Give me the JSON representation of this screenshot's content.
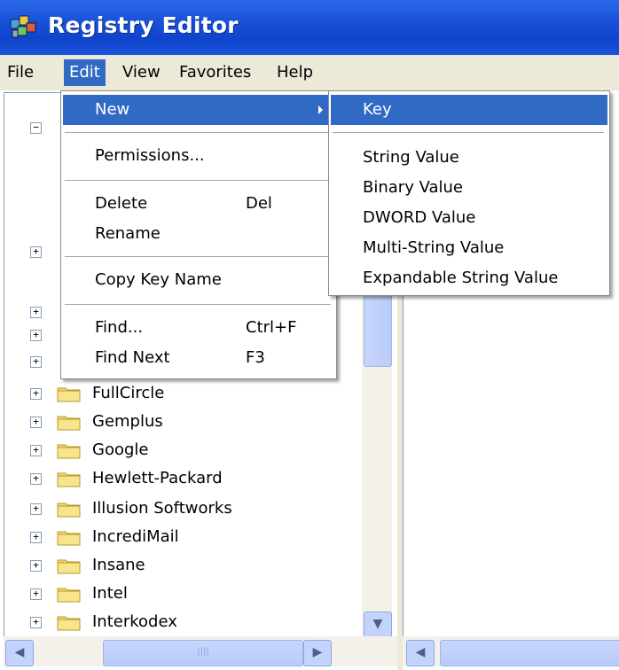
{
  "window": {
    "title": "Registry Editor"
  },
  "menubar": {
    "items": [
      "File",
      "Edit",
      "View",
      "Favorites",
      "Help"
    ],
    "active": "Edit"
  },
  "edit_menu": {
    "new": "New",
    "permissions": "Permissions...",
    "delete": "Delete",
    "delete_shortcut": "Del",
    "rename": "Rename",
    "copy_key_name": "Copy Key Name",
    "find": "Find...",
    "find_shortcut": "Ctrl+F",
    "find_next": "Find Next",
    "find_next_shortcut": "F3"
  },
  "new_submenu": {
    "items": [
      "Key",
      "String Value",
      "Binary Value",
      "DWORD Value",
      "Multi-String Value",
      "Expandable String Value"
    ],
    "selected": "Key"
  },
  "tree": {
    "items": [
      "FullCircle",
      "Gemplus",
      "Google",
      "Hewlett-Packard",
      "Illusion Softworks",
      "IncrediMail",
      "Insane",
      "Intel",
      "Interkodex"
    ]
  },
  "colors": {
    "title_bar": "#1850d8",
    "selection": "#316ac5",
    "menu_bar": "#ece9d8",
    "folder": "#f2d96f"
  }
}
